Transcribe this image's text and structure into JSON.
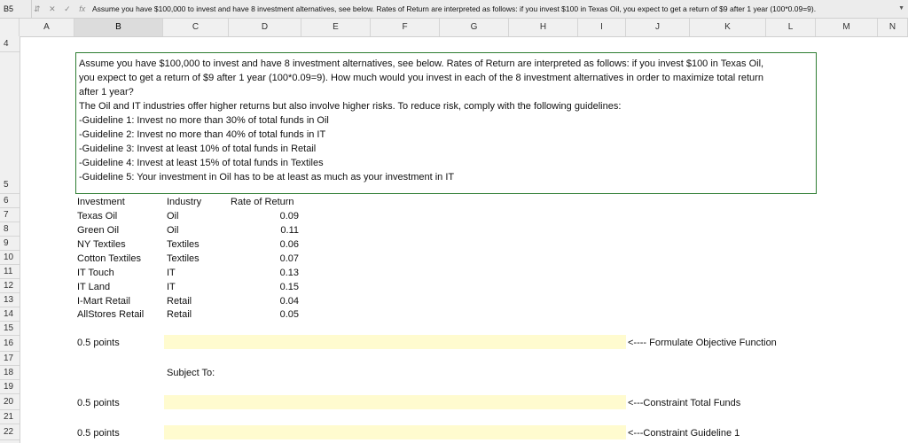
{
  "formula_bar": {
    "cell_ref": "B5",
    "icons": [
      "stepper-icon",
      "cancel-icon",
      "check-icon",
      "fx-icon"
    ],
    "formula": "Assume you have $100,000 to invest and have 8 investment alternatives, see below. Rates of Return are interpreted as follows: if you invest $100 in Texas Oil, you expect to get a return of $9 after 1 year (100*0.09=9)."
  },
  "columns": [
    "A",
    "B",
    "C",
    "D",
    "E",
    "F",
    "G",
    "H",
    "I",
    "J",
    "K",
    "L",
    "M",
    "N"
  ],
  "rows": [
    "4",
    "5",
    "6",
    "7",
    "8",
    "9",
    "10",
    "11",
    "12",
    "13",
    "14",
    "15",
    "16",
    "17",
    "18",
    "19",
    "20",
    "21",
    "22"
  ],
  "problem": {
    "lines": [
      "Assume you have $100,000 to invest and have 8 investment alternatives, see below. Rates of Return are interpreted as follows: if you invest $100 in Texas Oil,",
      "you expect to get a return of $9 after 1 year (100*0.09=9).  How much would you invest in each of the 8 investment alternatives in order to maximize total return",
      "after 1 year?",
      "The Oil and IT industries offer higher returns but also involve higher risks. To reduce risk, comply with the following guidelines:",
      "-Guideline 1: Invest no more than 30% of total funds in Oil",
      "-Guideline 2: Invest no more than 40% of total funds in IT",
      "-Guideline 3: Invest at least 10% of total funds in Retail",
      "-Guideline 4: Invest at least 15% of total funds in Textiles",
      "-Guideline 5: Your investment in Oil has to be at least as much as your investment in IT"
    ]
  },
  "table": {
    "headers": [
      "Investment",
      "Industry",
      "Rate of Return"
    ],
    "rows": [
      [
        "Texas Oil",
        "Oil",
        "0.09"
      ],
      [
        "Green Oil",
        "Oil",
        "0.11"
      ],
      [
        "NY Textiles",
        "Textiles",
        "0.06"
      ],
      [
        "Cotton Textiles",
        "Textiles",
        "0.07"
      ],
      [
        "IT Touch",
        "IT",
        "0.13"
      ],
      [
        "IT Land",
        "IT",
        "0.15"
      ],
      [
        "I-Mart Retail",
        "Retail",
        "0.04"
      ],
      [
        "AllStores Retail",
        "Retail",
        "0.05"
      ]
    ]
  },
  "sections": {
    "points_label": "0.5 points",
    "objective_note": "<---- Formulate Objective Function",
    "subject_to": "Subject To:",
    "constraint_total_note": "<---Constraint Total Funds",
    "constraint_g1_note": "<---Constraint Guideline 1"
  },
  "colors": {
    "answer_fill": "#fffbcf",
    "selection_border": "#2e7d32"
  }
}
